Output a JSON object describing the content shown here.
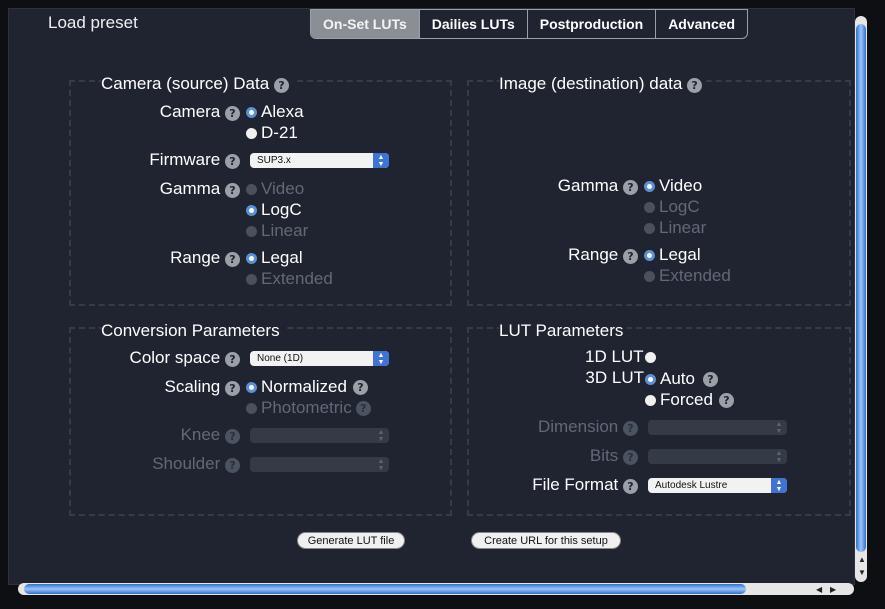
{
  "header": {
    "load_preset": "Load preset",
    "tabs": [
      "On-Set LUTs",
      "Dailies LUTs",
      "Postproduction",
      "Advanced"
    ]
  },
  "help_glyph": "?",
  "camera": {
    "title": "Camera (source) Data",
    "camera_label": "Camera",
    "camera_options": [
      "Alexa",
      "D-21"
    ],
    "firmware_label": "Firmware",
    "firmware_value": "SUP3.x",
    "gamma_label": "Gamma",
    "gamma_options": [
      "Video",
      "LogC",
      "Linear"
    ],
    "range_label": "Range",
    "range_options": [
      "Legal",
      "Extended"
    ]
  },
  "image": {
    "title": "Image (destination) data",
    "gamma_label": "Gamma",
    "gamma_options": [
      "Video",
      "LogC",
      "Linear"
    ],
    "range_label": "Range",
    "range_options": [
      "Legal",
      "Extended"
    ]
  },
  "conversion": {
    "title": "Conversion Parameters",
    "color_space_label": "Color space",
    "color_space_value": "None (1D)",
    "scaling_label": "Scaling",
    "scaling_options": [
      "Normalized",
      "Photometric"
    ],
    "knee_label": "Knee",
    "shoulder_label": "Shoulder"
  },
  "lut": {
    "title": "LUT Parameters",
    "lut1d_label": "1D LUT",
    "lut3d_label": "3D LUT",
    "lut3d_options": [
      "Auto",
      "Forced"
    ],
    "dimension_label": "Dimension",
    "bits_label": "Bits",
    "file_format_label": "File Format",
    "file_format_value": "Autodesk Lustre"
  },
  "buttons": {
    "generate": "Generate LUT file",
    "create_url": "Create URL for this setup"
  },
  "colors": {
    "background": "#1f2430",
    "accent": "#3f74d4",
    "disabled_text": "#616977"
  }
}
